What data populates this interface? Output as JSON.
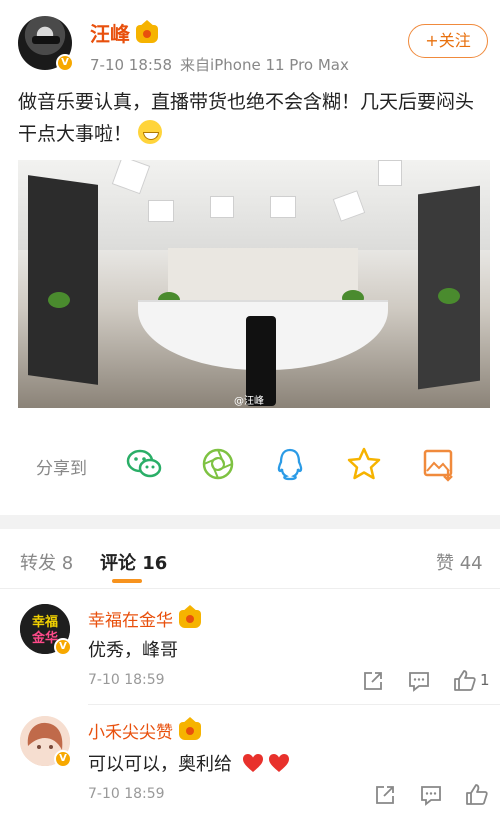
{
  "post": {
    "username": "汪峰",
    "time": "7-10 18:58",
    "source": "来自iPhone 11 Pro Max",
    "follow_label": "+关注",
    "text": "做音乐要认真，直播带货也绝不会含糊！几天后要闷头干点大事啦！",
    "photo_watermark": "@汪峰"
  },
  "share": {
    "label": "分享到",
    "targets": [
      "wechat-icon",
      "moments-icon",
      "qq-icon",
      "qzone-icon",
      "save-image-icon"
    ]
  },
  "tabs": {
    "repost": "转发 8",
    "comments": "评论 16",
    "likes": "赞 44"
  },
  "comments": [
    {
      "name": "幸福在金华",
      "avatar_text": "幸福 金华",
      "text": "优秀，峰哥",
      "time": "7-10 18:59",
      "like_count": "1"
    },
    {
      "name": "小禾尖尖赞",
      "text": "可以可以，奥利给",
      "time": "7-10 18:59",
      "like_count": ""
    }
  ],
  "colors": {
    "accent": "#e8500d",
    "orange": "#f7931e",
    "wechat_green": "#2aae67",
    "qq_blue": "#2b9be6",
    "gold": "#f6b300"
  }
}
